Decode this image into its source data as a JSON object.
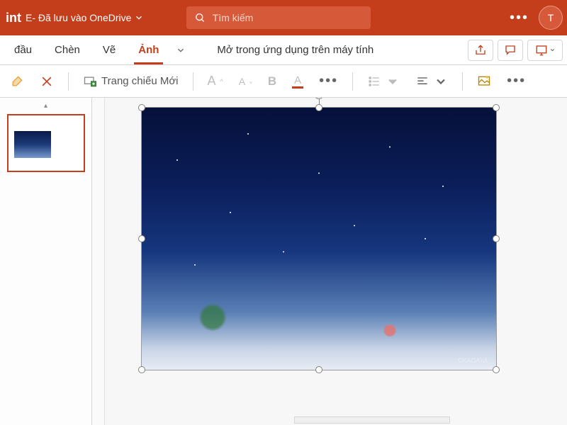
{
  "titlebar": {
    "app_name_fragment": "int",
    "doc_status": "E- Đã lưu vào OneDrive",
    "search_placeholder": "Tìm kiếm",
    "avatar_initial": "T"
  },
  "tabs": {
    "items": [
      {
        "label": "đầu",
        "active": false
      },
      {
        "label": "Chèn",
        "active": false
      },
      {
        "label": "Vẽ",
        "active": false
      },
      {
        "label": "Ảnh",
        "active": true
      }
    ],
    "open_desktop_label": "Mở trong ứng dụng trên máy tính"
  },
  "toolbar": {
    "new_slide_label": "Trang chiếu Mới",
    "font_increase": "A",
    "font_decrease": "A",
    "bold": "B",
    "font_color": "A"
  },
  "colors": {
    "brand": "#c43e1c",
    "toolbar_accent": "#c43e1c"
  },
  "image_credit": {
    "author": "©KAGAYA"
  }
}
